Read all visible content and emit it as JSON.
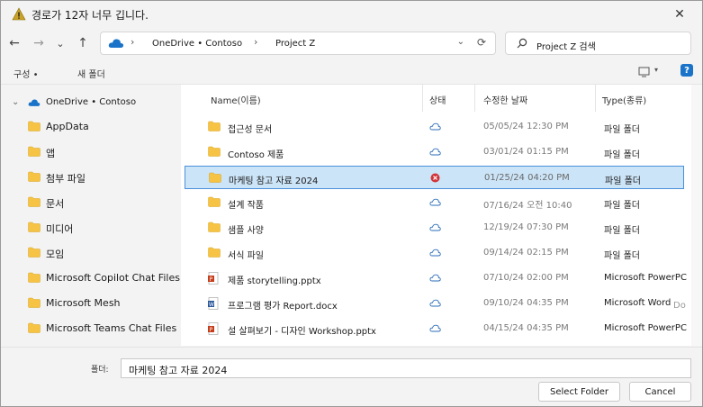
{
  "title": "경로가 12자 너무 깁니다.",
  "close_symbol": "✕",
  "nav": {
    "back": "←",
    "forward": "→",
    "recent": "⌄",
    "up": "↑",
    "crumbs": [
      "OneDrive • Contoso",
      "Project Z"
    ],
    "dropdown": "⌄",
    "refresh": "⟳"
  },
  "search": {
    "placeholder": "Project Z 검색"
  },
  "toolbar": {
    "organize": "구성 •",
    "new_folder": "새 폴더",
    "view_caret": "▾",
    "help": "?"
  },
  "sidebar": {
    "root": "OneDrive • Contoso",
    "items": [
      "AppData",
      "앱",
      "첨부 파일",
      "문서",
      "미디어",
      "모임",
      "Microsoft Copilot Chat Files",
      "Microsoft Mesh",
      "Microsoft Teams Chat Files"
    ]
  },
  "columns": {
    "name": "Name(이름)",
    "status": "상태",
    "date": "수정한 날짜",
    "type": "Type(종류)"
  },
  "files": [
    {
      "name": "접근성 문서",
      "icon": "folder-icon",
      "status": "cloud",
      "date": "05/05/24 12:30 PM",
      "type": "파일 폴더"
    },
    {
      "name": "Contoso 제품",
      "icon": "folder-icon",
      "status": "cloud",
      "date": "03/01/24 01:15 PM",
      "type": "파일 폴더"
    },
    {
      "name": "마케팅 참고 자료 2024",
      "icon": "folder-icon",
      "status": "error",
      "date": "01/25/24 04:20 PM",
      "type": "파일 폴더"
    },
    {
      "name": "설계 작품",
      "icon": "folder-icon",
      "status": "cloud",
      "date": "07/16/24 오전 10:40",
      "type": "파일 폴더"
    },
    {
      "name": "샘플 사양",
      "icon": "folder-icon",
      "status": "cloud",
      "date": "12/19/24 07:30 PM",
      "type": "파일 폴더"
    },
    {
      "name": "서식 파일",
      "icon": "folder-icon",
      "status": "cloud",
      "date": "09/14/24 02:15 PM",
      "type": "파일 폴더"
    },
    {
      "name": "제품 storytelling.pptx",
      "icon": "powerpoint-icon",
      "status": "cloud",
      "date": "07/10/24 02:00 PM",
      "type": "Microsoft PowerPC"
    },
    {
      "name": "프로그램 평가 Report.docx",
      "icon": "word-icon",
      "status": "cloud",
      "date": "09/10/24 04:35 PM",
      "type": "Microsoft Word"
    },
    {
      "name": "설 살펴보기 - 디자인 Workshop.pptx",
      "icon": "powerpoint-icon",
      "status": "cloud",
      "date": "04/15/24 04:35 PM",
      "type": "Microsoft PowerPC"
    }
  ],
  "type_overflow": "Do",
  "footer": {
    "folder_label": "폴더:",
    "folder_value": "마케팅 참고 자료 2024",
    "select_button": "Select Folder",
    "cancel_button": "Cancel"
  },
  "colors": {
    "accent": "#1a73c9",
    "selection": "#cce4f7",
    "folder": "#f6c344",
    "error": "#d13438"
  }
}
